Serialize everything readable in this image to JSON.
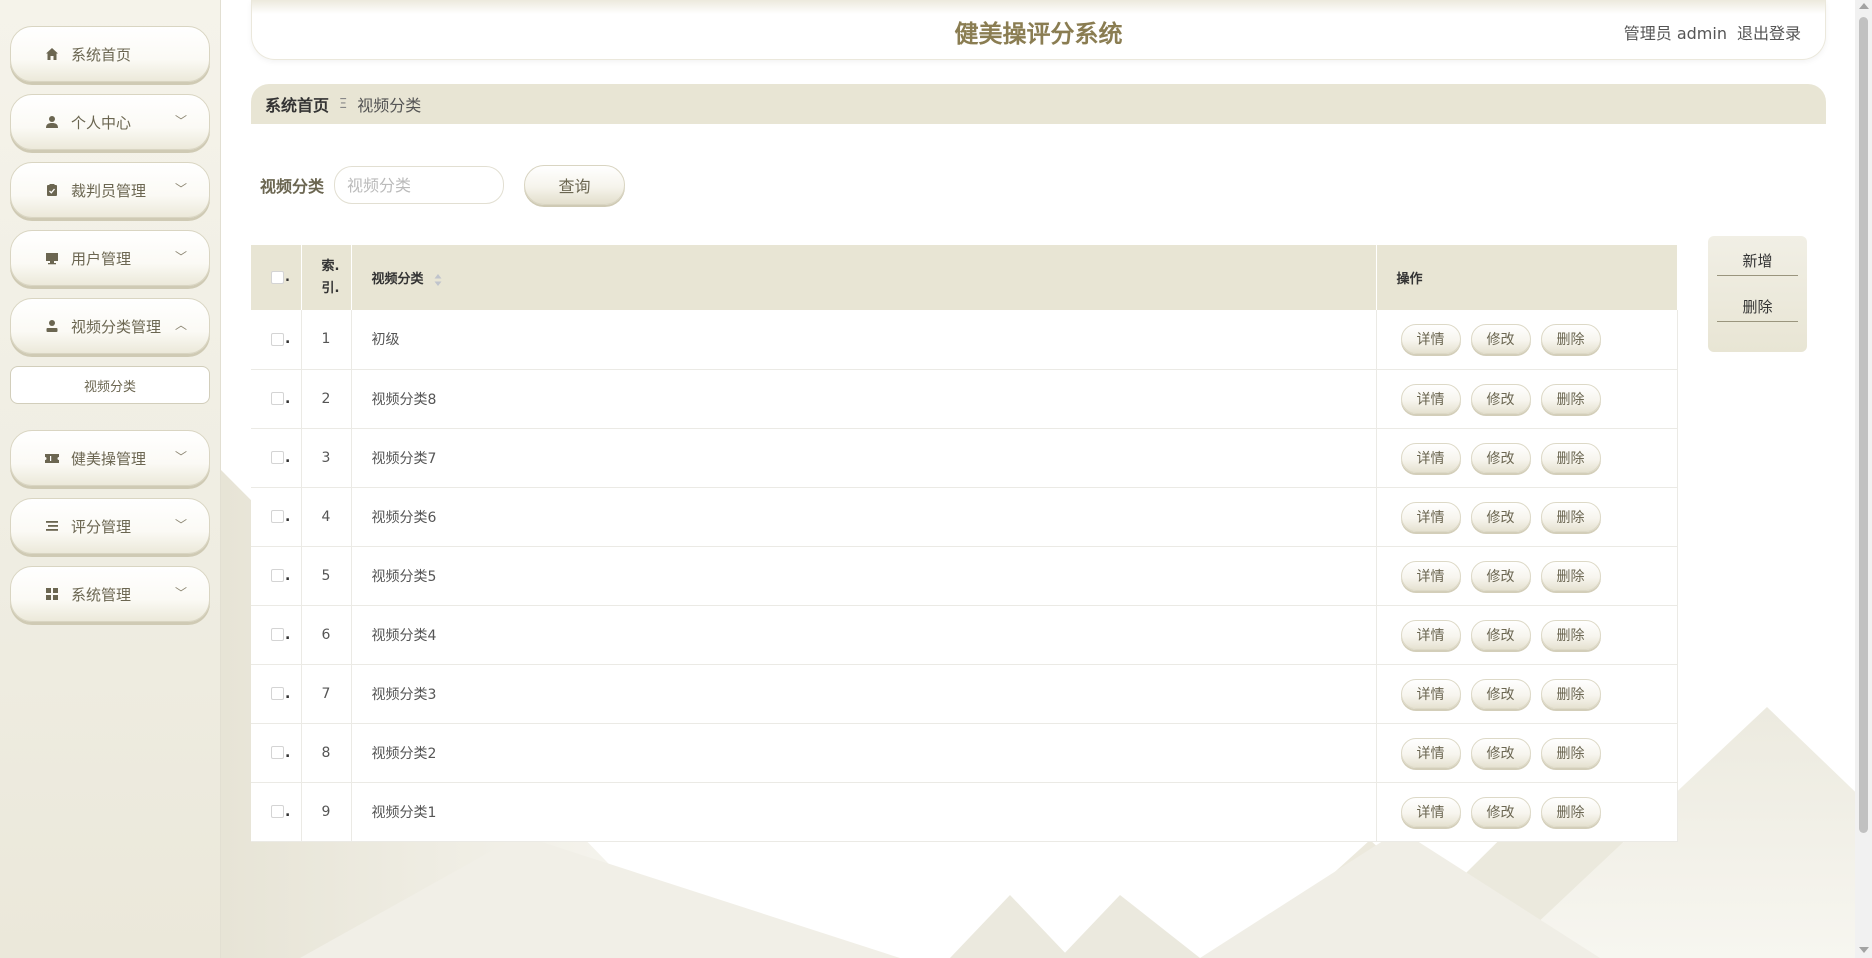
{
  "header": {
    "title": "健美操评分系统",
    "user_label": "管理员 admin",
    "logout_label": "退出登录"
  },
  "sidebar": {
    "items": [
      {
        "label": "系统首页",
        "icon": "home-icon",
        "has_chevron": false
      },
      {
        "label": "个人中心",
        "icon": "user-icon",
        "has_chevron": true,
        "chevron": "down"
      },
      {
        "label": "裁判员管理",
        "icon": "clipboard-icon",
        "has_chevron": true,
        "chevron": "down"
      },
      {
        "label": "用户管理",
        "icon": "monitor-icon",
        "has_chevron": true,
        "chevron": "down"
      },
      {
        "label": "视频分类管理",
        "icon": "person-icon",
        "has_chevron": true,
        "chevron": "up"
      },
      {
        "label": "健美操管理",
        "icon": "ticket-icon",
        "has_chevron": true,
        "chevron": "down"
      },
      {
        "label": "评分管理",
        "icon": "list-icon",
        "has_chevron": true,
        "chevron": "down"
      },
      {
        "label": "系统管理",
        "icon": "grid-icon",
        "has_chevron": true,
        "chevron": "down"
      }
    ],
    "submenu": {
      "label": "视频分类"
    }
  },
  "breadcrumb": {
    "home": "系统首页",
    "separator": "Ξ",
    "current": "视频分类"
  },
  "search": {
    "label": "视频分类",
    "placeholder": "视频分类",
    "button": "查询"
  },
  "table": {
    "headers": {
      "check_suffix": ".",
      "index": "索.\n引.",
      "name": "视频分类",
      "ops": "操作"
    },
    "rows": [
      {
        "index": "1",
        "name": "初级"
      },
      {
        "index": "2",
        "name": "视频分类8"
      },
      {
        "index": "3",
        "name": "视频分类7"
      },
      {
        "index": "4",
        "name": "视频分类6"
      },
      {
        "index": "5",
        "name": "视频分类5"
      },
      {
        "index": "6",
        "name": "视频分类4"
      },
      {
        "index": "7",
        "name": "视频分类3"
      },
      {
        "index": "8",
        "name": "视频分类2"
      },
      {
        "index": "9",
        "name": "视频分类1"
      }
    ],
    "row_actions": {
      "detail": "详情",
      "edit": "修改",
      "delete": "删除"
    }
  },
  "actions": {
    "add": "新增",
    "delete": "删除"
  },
  "colors": {
    "accent": "#8a7d52",
    "header_bg": "#e8e5d4",
    "sidebar_text": "#6b6651"
  }
}
